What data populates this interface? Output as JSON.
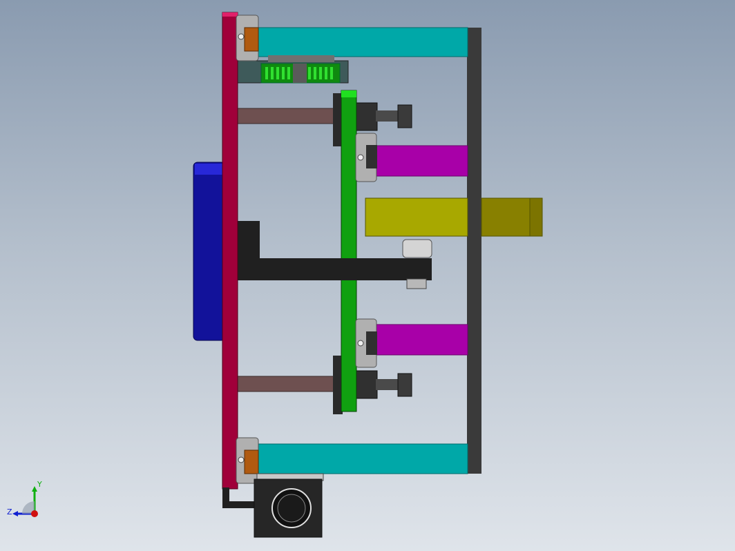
{
  "view": {
    "background_top": "#8a9bb0",
    "background_bottom": "#dfe4ea"
  },
  "model": {
    "colors": {
      "main_plate": "#a0003a",
      "blue_motor": "#12129a",
      "cyan_rail": "#00a8a8",
      "magenta_rail": "#a800a8",
      "green_plate": "#10a010",
      "olive_block": "#a8a800",
      "olive_block_dark": "#888000",
      "frame": "#3a3a3a",
      "rod": "#6e5050",
      "bracket": "#202020",
      "orange_pad": "#b05a10"
    }
  },
  "triad": {
    "y_label": "Y",
    "z_label": "Z",
    "y_color": "#10b010",
    "z_color": "#1020d0",
    "x_color": "#d01010"
  }
}
